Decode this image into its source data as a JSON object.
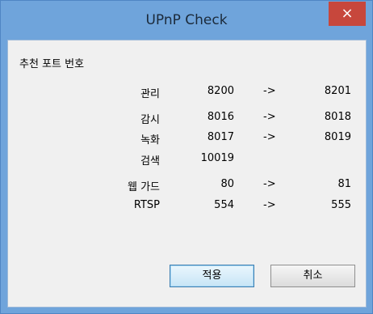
{
  "window": {
    "title": "UPnP Check",
    "close_glyph": "×"
  },
  "section_title": "추천 포트 번호",
  "ports": [
    {
      "name": "관리",
      "from": "8200",
      "arrow": "->",
      "to": "8201"
    },
    {
      "name": "감시",
      "from": "8016",
      "arrow": "->",
      "to": "8018"
    },
    {
      "name": "녹화",
      "from": "8017",
      "arrow": "->",
      "to": "8019"
    },
    {
      "name": "검색",
      "from": "10019",
      "arrow": "",
      "to": ""
    },
    {
      "name": "웹 가드",
      "from": "80",
      "arrow": "->",
      "to": "81"
    },
    {
      "name": "RTSP",
      "from": "554",
      "arrow": "->",
      "to": "555"
    }
  ],
  "buttons": {
    "apply": "적용",
    "cancel": "취소"
  },
  "colors": {
    "frame": "#6fa4db",
    "close": "#c7473c",
    "client": "#f0f0f0"
  }
}
